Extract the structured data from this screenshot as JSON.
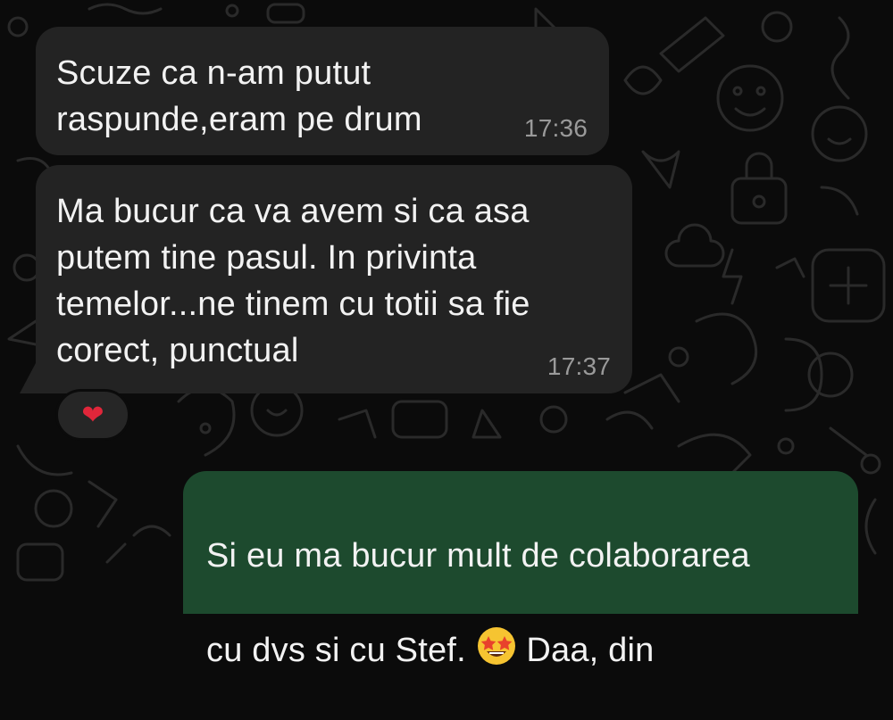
{
  "colors": {
    "background": "#0b0b0b",
    "incoming_bubble": "#232323",
    "outgoing_bubble": "#1d4a2e",
    "text": "#f2f2f2",
    "timestamp": "#9a9a9a",
    "heart": "#e0263a"
  },
  "messages": [
    {
      "direction": "incoming",
      "text": "Scuze ca n-am putut\nraspunde,eram pe drum",
      "time": "17:36"
    },
    {
      "direction": "incoming",
      "text": "Ma bucur ca va avem si ca asa\nputem tine pasul. In privinta\ntemelor...ne tinem cu totii sa fie\ncorect, punctual",
      "time": "17:37",
      "reaction": "❤"
    },
    {
      "direction": "outgoing",
      "text_line1": "Si eu ma bucur mult de colaborarea",
      "text_line2_before": "cu dvs si cu Stef. ",
      "text_line2_emoji": "star-struck-emoji",
      "text_line2_after": " Daa, din"
    }
  ]
}
